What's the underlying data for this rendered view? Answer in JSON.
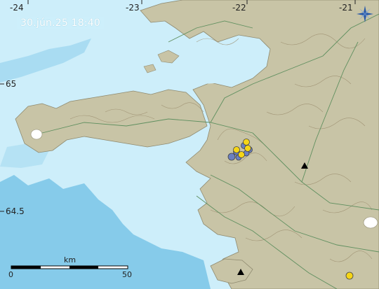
{
  "timestamp": "30.jún.25 18:40",
  "lon_labels": [
    "-24",
    "-23",
    "-22",
    "-21"
  ],
  "lat_labels": [
    "65",
    "64.5"
  ],
  "scale": {
    "unit": "km",
    "start": "0",
    "end": "50"
  },
  "colors": {
    "sea_shallow": "#cdeefa",
    "sea_deep": "#86cbea",
    "land": "#c8c4a6",
    "contour": "#9a8c6d",
    "roads": "#5f8f5f",
    "quake_recent": "#f5d516",
    "quake_older": "#6a7fc1",
    "volcano": "#000000"
  },
  "markers": {
    "earthquakes_yellow": 5,
    "earthquakes_blue": 6,
    "volcanoes": 2
  },
  "icons": {
    "compass": "compass-rose-icon"
  }
}
